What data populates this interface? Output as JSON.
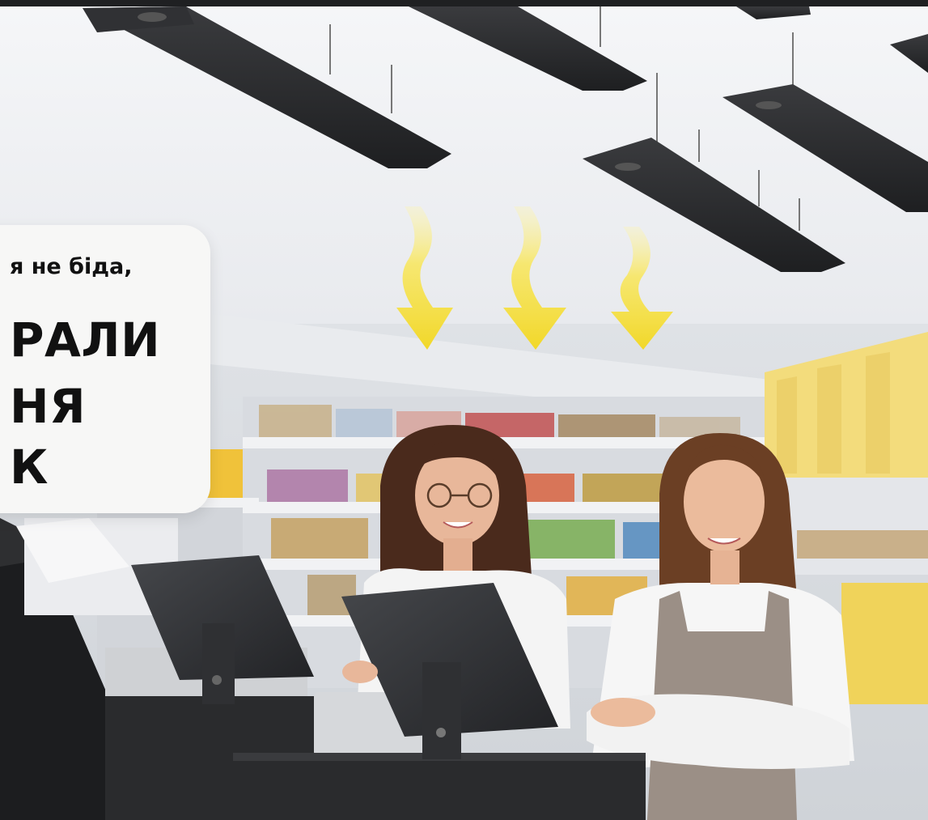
{
  "banner": {
    "line1": "я не біда,",
    "line2": "РАЛИ",
    "line3": "НЯ",
    "line4": "К"
  },
  "colors": {
    "ceiling": "#eef0f3",
    "heater": "#2b2c2e",
    "arrow": "#f7e24a",
    "counter": "#2a2b2d",
    "apron": "#9b8f86",
    "callout_bg": "#f7f7f6"
  }
}
